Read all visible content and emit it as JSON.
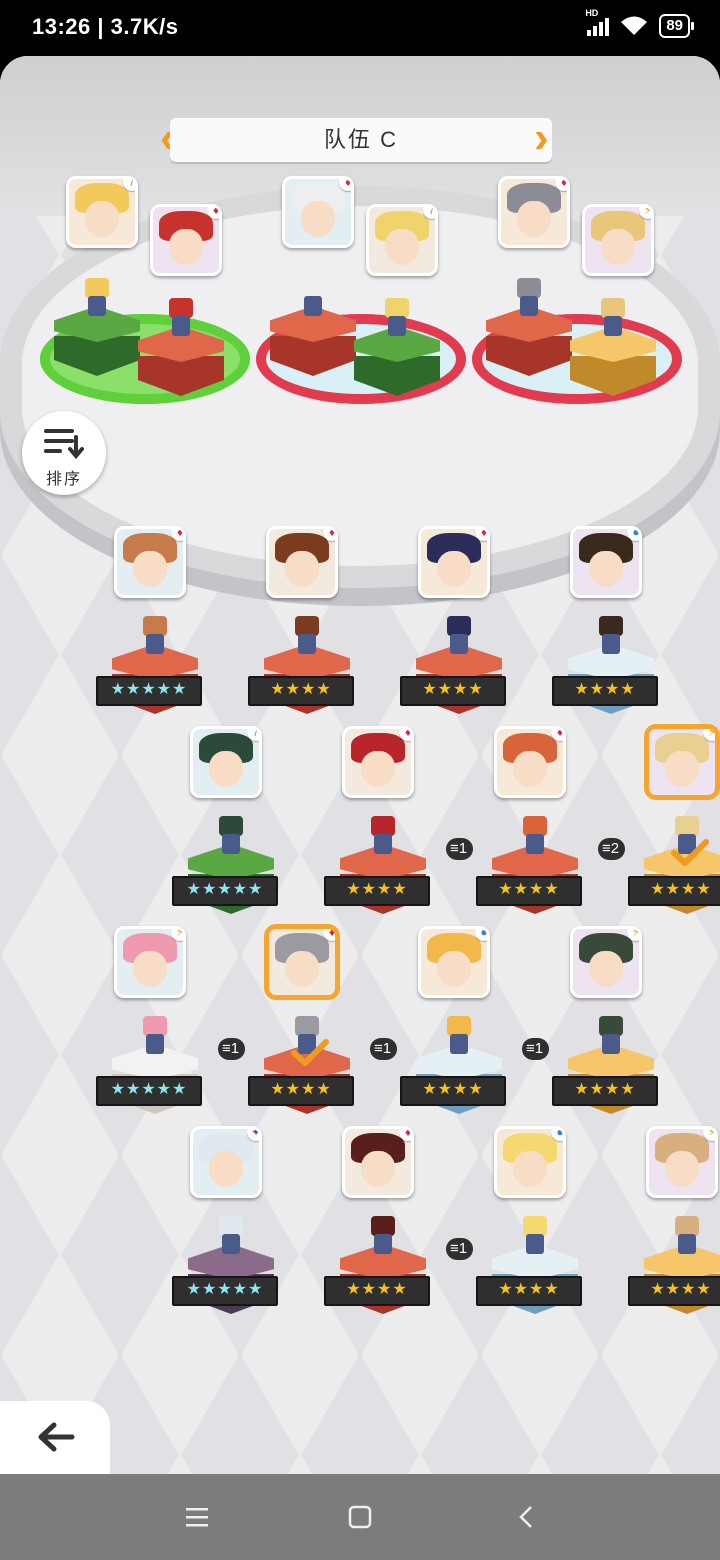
{
  "status_bar": {
    "time": "13:26 | 3.7K/s",
    "network_label": "HD",
    "battery": "89"
  },
  "team": {
    "name": "队伍 C",
    "slots": [
      {
        "color": "#5fcf3b",
        "members": [
          {
            "element": "wind"
          },
          {
            "element": "fire"
          }
        ]
      },
      {
        "color": "#e23a4e",
        "members": [
          {
            "element": "fire"
          },
          {
            "element": "wind"
          }
        ]
      },
      {
        "color": "#e23a4e",
        "members": [
          {
            "element": "fire"
          },
          {
            "element": "light"
          }
        ]
      }
    ]
  },
  "sort_button": {
    "label": "排序"
  },
  "roster": [
    {
      "element": "fire",
      "stars": "★★★★★",
      "rarity": "5",
      "pedestal": "red"
    },
    {
      "element": "fire",
      "stars": "★★★★",
      "rarity": "4",
      "pedestal": "red"
    },
    {
      "element": "fire",
      "stars": "★★★★",
      "rarity": "4",
      "pedestal": "red"
    },
    {
      "element": "water",
      "stars": "★★★★",
      "rarity": "4",
      "pedestal": "ice"
    },
    {
      "element": "wind",
      "stars": "★★★★★",
      "rarity": "5",
      "pedestal": "green"
    },
    {
      "element": "fire",
      "stars": "★★★★",
      "rarity": "4",
      "pedestal": "red"
    },
    {
      "element": "fire",
      "stars": "★★★★",
      "rarity": "4",
      "pedestal": "red",
      "level": "1"
    },
    {
      "element": "light",
      "stars": "★★★★",
      "rarity": "4",
      "pedestal": "gold",
      "level": "2",
      "in_team": true,
      "selected": true
    },
    {
      "element": "light",
      "stars": "★★★★★",
      "rarity": "5",
      "pedestal": "white"
    },
    {
      "element": "fire",
      "stars": "★★★★",
      "rarity": "4",
      "pedestal": "red",
      "level": "1",
      "in_team": true,
      "selected": true
    },
    {
      "element": "water",
      "stars": "★★★★",
      "rarity": "4",
      "pedestal": "ice",
      "level": "1"
    },
    {
      "element": "light",
      "stars": "★★★★",
      "rarity": "4",
      "pedestal": "gold",
      "level": "1"
    },
    {
      "element": "dark",
      "stars": "★★★★★",
      "rarity": "5",
      "pedestal": "purple"
    },
    {
      "element": "fire",
      "stars": "★★★★",
      "rarity": "4",
      "pedestal": "red"
    },
    {
      "element": "water",
      "stars": "★★★★",
      "rarity": "4",
      "pedestal": "ice",
      "level": "1"
    },
    {
      "element": "light",
      "stars": "★★★★",
      "rarity": "4",
      "pedestal": "gold"
    }
  ],
  "back_button": {
    "label": "返回"
  },
  "colors": {
    "accent": "#f39a1e",
    "fire": "#d8263c",
    "wind": "#6ab632",
    "light": "#e0a818",
    "water": "#2a84e6",
    "dark": "#7d3fa0"
  }
}
